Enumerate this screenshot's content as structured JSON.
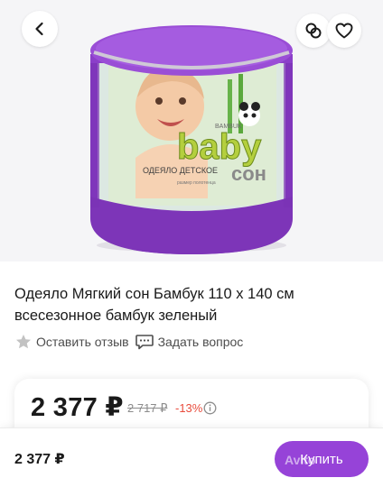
{
  "product": {
    "title": "Одеяло Мягкий сон Бамбук 110 х 140 см всесезонное бамбук зеленый",
    "image_colors": {
      "bag": "#8b3fc9",
      "bag_dark": "#6a2aa0",
      "background": "#f5f5f7"
    },
    "package_text": {
      "logo": "baby",
      "brand": "сон",
      "small_label": "BAMBUK",
      "label": "ОДЕЯЛО ДЕТСКОЕ",
      "sublabel": "размер полотенца"
    }
  },
  "actions": {
    "review_label": "Оставить отзыв",
    "question_label": "Задать вопрос"
  },
  "pricing": {
    "price": "2 377 ₽",
    "old_price": "2 717 ₽",
    "discount": "-13%"
  },
  "bottom_bar": {
    "price": "2 377 ₽",
    "buy_label": "Купить",
    "watermark": "Avito",
    "accent_color": "#9643d8"
  },
  "icons": {
    "back": "chevron-left-icon",
    "compare": "compare-icon",
    "favorite": "heart-icon",
    "review": "star-icon",
    "question": "chat-icon",
    "info": "info-icon"
  }
}
